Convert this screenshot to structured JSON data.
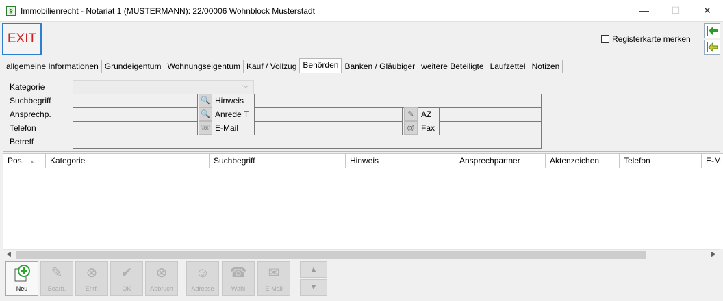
{
  "window": {
    "title": "Immobilienrecht - Notariat 1 (MUSTERMANN): 22/00006 Wohnblock Musterstadt",
    "app_icon_glyph": "§",
    "minimize": "—",
    "maximize": "☐",
    "close": "✕"
  },
  "topbar": {
    "exit_label": "EXIT",
    "remember_label": "Registerkarte merken"
  },
  "tabs": [
    {
      "label": "allgemeine Informationen"
    },
    {
      "label": "Grundeigentum"
    },
    {
      "label": "Wohnungseigentum"
    },
    {
      "label": "Kauf / Vollzug"
    },
    {
      "label": "Behörden",
      "active": true
    },
    {
      "label": "Banken / Gläubiger"
    },
    {
      "label": "weitere Beteiligte"
    },
    {
      "label": "Laufzettel"
    },
    {
      "label": "Notizen"
    }
  ],
  "form": {
    "kategorie": "Kategorie",
    "suchbegriff": "Suchbegriff",
    "ansprechp": "Ansprechp.",
    "telefon": "Telefon",
    "betreff": "Betreff",
    "hinweis": "Hinweis",
    "anrede": "Anrede T",
    "email": "E-Mail",
    "az": "AZ",
    "fax": "Fax"
  },
  "grid": {
    "columns": [
      {
        "label": "Pos."
      },
      {
        "label": "Kategorie"
      },
      {
        "label": "Suchbegriff"
      },
      {
        "label": "Hinweis"
      },
      {
        "label": "Ansprechpartner"
      },
      {
        "label": "Aktenzeichen"
      },
      {
        "label": "Telefon"
      },
      {
        "label": "E-M"
      }
    ]
  },
  "toolbar": {
    "buttons": [
      {
        "label": "Neu",
        "enabled": true,
        "icon": "add-icon"
      },
      {
        "label": "Bearb.",
        "enabled": false,
        "icon": "edit-icon"
      },
      {
        "label": "Entf.",
        "enabled": false,
        "icon": "delete-icon"
      },
      {
        "label": "OK",
        "enabled": false,
        "icon": "check-icon"
      },
      {
        "label": "Abbruch",
        "enabled": false,
        "icon": "cancel-icon"
      },
      {
        "label": "Adresse",
        "enabled": false,
        "icon": "address-icon"
      },
      {
        "label": "Wahl",
        "enabled": false,
        "icon": "dial-icon"
      },
      {
        "label": "E-Mail",
        "enabled": false,
        "icon": "mail-icon"
      }
    ]
  },
  "colors": {
    "exit_text": "#d02020",
    "exit_border": "#2f7fd0",
    "add_green": "#2fa52f",
    "nav_green": "#2a9a2a"
  }
}
